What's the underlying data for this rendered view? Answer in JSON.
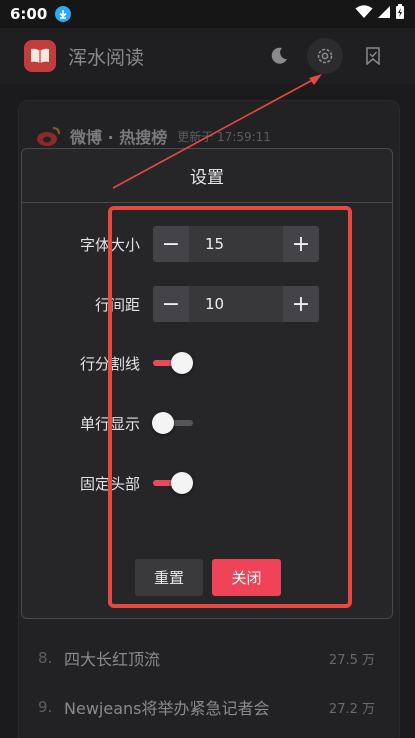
{
  "status_bar": {
    "time": "6:00",
    "download_icon": "download-icon",
    "wifi_icon": "wifi-icon",
    "signal_icon": "signal-icon",
    "battery_icon": "battery-charging-icon"
  },
  "header": {
    "title": "浑水阅读",
    "logo_icon": "book-icon",
    "actions": [
      "moon-icon",
      "gear-icon",
      "bookmark-icon"
    ]
  },
  "background": {
    "weibo_title": "微博 · 热搜榜",
    "updated": "更新于 17:59:11",
    "items": [
      {
        "index": "8.",
        "text": "四大长红顶流",
        "count": "27.5 万"
      },
      {
        "index": "9.",
        "text": "Newjeans将举办紧急记者会",
        "count": "27.2 万"
      }
    ]
  },
  "dialog": {
    "title": "设置",
    "font_size": {
      "label": "字体大小",
      "value": "15",
      "minus": "−",
      "plus": "+"
    },
    "line_spacing": {
      "label": "行间距",
      "value": "10",
      "minus": "−",
      "plus": "+"
    },
    "line_divider": {
      "label": "行分割线",
      "on": true
    },
    "single_line": {
      "label": "单行显示",
      "on": false
    },
    "fixed_header": {
      "label": "固定头部",
      "on": true
    },
    "reset_label": "重置",
    "close_label": "关闭"
  },
  "colors": {
    "accent": "#ef4357",
    "annotation": "#e8483f",
    "logo": "#c43d3d"
  }
}
